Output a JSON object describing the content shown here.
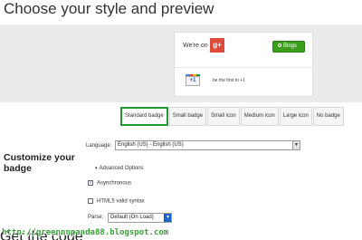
{
  "page": {
    "title": "Choose your style and preview"
  },
  "badge": {
    "were_on": "We're on",
    "gplus_logo": "g+",
    "follow_label": "Blogs",
    "plusone_label": "+1",
    "first_text": "be the first to +1"
  },
  "tabs": [
    {
      "label": "Standard badge",
      "active": true
    },
    {
      "label": "Small badge",
      "active": false
    },
    {
      "label": "Small icon",
      "active": false
    },
    {
      "label": "Medium icon",
      "active": false
    },
    {
      "label": "Large icon",
      "active": false
    },
    {
      "label": "No badge",
      "active": false
    }
  ],
  "customize": {
    "title": "Customize your badge",
    "language_label": "Language:",
    "language_value": "English (US) - English (US)",
    "advanced_toggle": "Advanced Options",
    "async_label": "Asynchronous",
    "async_checked": true,
    "html5_label": "HTML5 valid syntax",
    "html5_checked": false,
    "parse_label": "Parse:",
    "parse_value": "Default (On Load)"
  },
  "footer": {
    "watermark": "http://greennnpanda88.blogspot.com",
    "cut_heading": "Get the code"
  },
  "colors": {
    "accent_green": "#1f9a2e",
    "gplus_red": "#dd4b39",
    "follow_green": "#3b9e1d"
  }
}
